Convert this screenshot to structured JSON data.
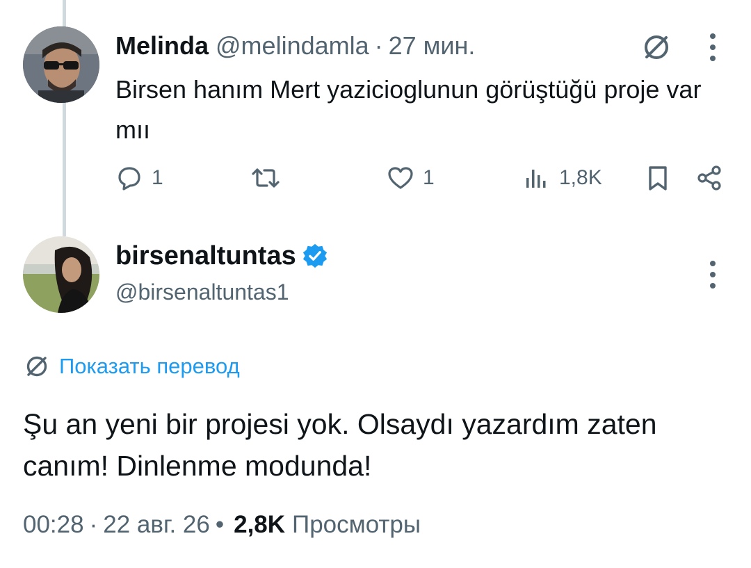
{
  "reply": {
    "name": "Melinda",
    "handle": "@melindamla",
    "separator": "·",
    "time": "27 мин.",
    "text": "Birsen hanım Mert yazicioglunun görüştüğü proje var mıı",
    "actions": {
      "replies": "1",
      "reposts": "",
      "likes": "1",
      "views": "1,8K"
    }
  },
  "main_tweet": {
    "name": "birsenaltuntas",
    "handle": "@birsenaltuntas1",
    "verified": true,
    "show_translation": "Показать перевод",
    "text": "Şu an yeni bir projesi yok. Olsaydı yazardım zaten canım! Dinlenme modunda!",
    "time": "00:28",
    "date": "22 авг. 26",
    "dot1": "·",
    "dot2": "•",
    "views_count": "2,8K",
    "views_label": "Просмотры"
  },
  "icons": {
    "translate": "translate-icon",
    "more": "more-vertical-icon",
    "reply": "reply-icon",
    "repost": "repost-icon",
    "like": "heart-icon",
    "analytics": "analytics-icon",
    "bookmark": "bookmark-icon",
    "share": "share-icon",
    "verified": "verified-badge-icon"
  },
  "colors": {
    "text": "#0f1419",
    "secondary": "#536471",
    "link": "#1d9bf0",
    "thread_line": "#cfd9de"
  }
}
